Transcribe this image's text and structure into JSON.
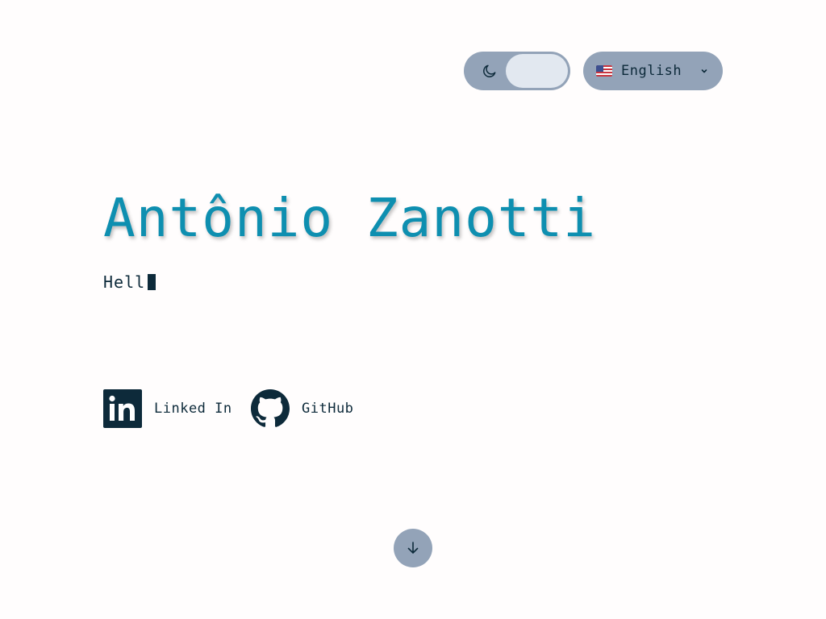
{
  "header": {
    "theme_toggle": {
      "icon": "moon-icon",
      "state": "light"
    },
    "language": {
      "flag": "us-flag-icon",
      "selected": "English",
      "icon": "chevron-down-icon"
    }
  },
  "hero": {
    "name": "Antônio Zanotti",
    "typing_text": "Hell"
  },
  "social": [
    {
      "label": "Linked In",
      "icon": "linkedin-icon"
    },
    {
      "label": "GitHub",
      "icon": "github-icon"
    }
  ],
  "scroll_down": {
    "icon": "arrow-down-icon"
  },
  "colors": {
    "accent": "#0e8fb0",
    "text": "#0d2a3a",
    "control_bg": "#93a3b8",
    "knob": "#e2e8f0",
    "background": "#fffdfd"
  }
}
